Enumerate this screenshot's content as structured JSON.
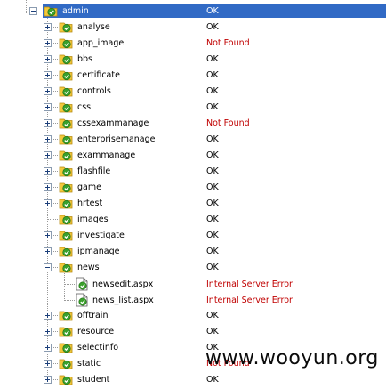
{
  "tree": {
    "root": {
      "name": "admin",
      "status": "OK"
    },
    "children": [
      {
        "name": "analyse",
        "status": "OK"
      },
      {
        "name": "app_image",
        "status": "Not Found"
      },
      {
        "name": "bbs",
        "status": "OK"
      },
      {
        "name": "certificate",
        "status": "OK"
      },
      {
        "name": "controls",
        "status": "OK"
      },
      {
        "name": "css",
        "status": "OK"
      },
      {
        "name": "cssexammanage",
        "status": "Not Found"
      },
      {
        "name": "enterprisemanage",
        "status": "OK"
      },
      {
        "name": "exammanage",
        "status": "OK"
      },
      {
        "name": "flashfile",
        "status": "OK"
      },
      {
        "name": "game",
        "status": "OK"
      },
      {
        "name": "hrtest",
        "status": "OK"
      },
      {
        "name": "images",
        "status": "OK"
      },
      {
        "name": "investigate",
        "status": "OK"
      },
      {
        "name": "ipmanage",
        "status": "OK"
      },
      {
        "name": "news",
        "status": "OK"
      },
      {
        "name": "newsedit.aspx",
        "status": "Internal Server Error"
      },
      {
        "name": "news_list.aspx",
        "status": "Internal Server Error"
      },
      {
        "name": "offtrain",
        "status": "OK"
      },
      {
        "name": "resource",
        "status": "OK"
      },
      {
        "name": "selectinfo",
        "status": "OK"
      },
      {
        "name": "static",
        "status": "Not Found"
      },
      {
        "name": "student",
        "status": "OK"
      }
    ]
  },
  "watermark": "www.wooyun.org",
  "colors": {
    "selection": "#316ac5",
    "error": "#c00000",
    "folder_green": "#3aa02c",
    "folder_yellow": "#f3c83a"
  }
}
